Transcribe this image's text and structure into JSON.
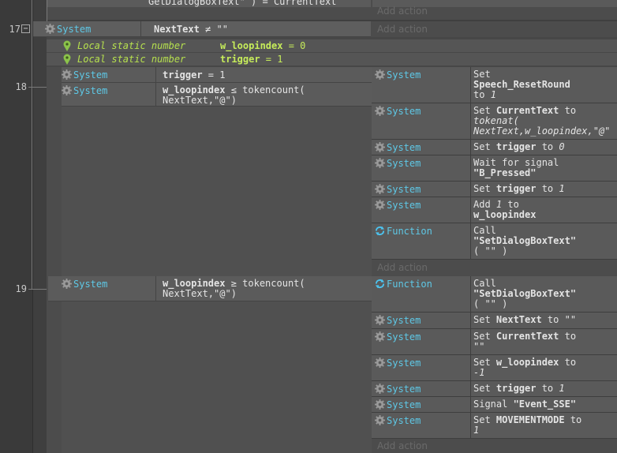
{
  "lines": [
    "17",
    "18",
    "19"
  ],
  "fold_sign": "−",
  "top": {
    "cond_text": "GetDialogBoxText\" ) = CurrentText",
    "add_action": "Add action"
  },
  "e17": {
    "obj": "System",
    "cond_var": "NextText",
    "cond_rest": " ≠ \"\"",
    "add_action": "Add action",
    "locals": [
      {
        "label": "Local static number",
        "name": "w_loopindex",
        "value": " = 0"
      },
      {
        "label": "Local static number",
        "name": "trigger",
        "value": " = 1"
      }
    ]
  },
  "e18": {
    "c1": {
      "obj": "System",
      "var": "trigger",
      "rest": " = 1"
    },
    "c2": {
      "obj": "System",
      "var": "w_loopindex",
      "rest": " ≤ tokencount(",
      "line2": "NextText,\"@\")"
    },
    "a1": {
      "obj": "System",
      "l1": "Set",
      "l2": "Speech_ResetRound",
      "l3a": "to ",
      "l3b": "1"
    },
    "a2": {
      "obj": "System",
      "l1a": "Set ",
      "l1b": "CurrentText",
      "l1c": " to",
      "l2": "tokenat(",
      "l3": "NextText,w_loopindex,\"@\""
    },
    "a3": {
      "obj": "System",
      "p1": "Set ",
      "p2": "trigger",
      "p3": " to ",
      "p4": "0"
    },
    "a4": {
      "obj": "System",
      "l1": "Wait for signal",
      "l2": "\"B_Pressed\""
    },
    "a5": {
      "obj": "System",
      "p1": "Set ",
      "p2": "trigger",
      "p3": " to ",
      "p4": "1"
    },
    "a6": {
      "obj": "System",
      "l1a": "Add ",
      "l1b": "1",
      "l1c": " to",
      "l2": "w_loopindex"
    },
    "a7": {
      "obj": "Function",
      "l1": "Call",
      "l2": "\"SetDialogBoxText\"",
      "l3": "( \"\" )"
    },
    "add_action": "Add action"
  },
  "e19": {
    "c1": {
      "obj": "System",
      "var": "w_loopindex",
      "rest": " ≥ tokencount(",
      "line2": "NextText,\"@\")"
    },
    "a1": {
      "obj": "Function",
      "l1": "Call",
      "l2": "\"SetDialogBoxText\"",
      "l3": "( \"\" )"
    },
    "a2": {
      "obj": "System",
      "p1": "Set ",
      "p2": "NextText",
      "p3": " to ",
      "p4": "\"\""
    },
    "a3": {
      "obj": "System",
      "l1a": "Set ",
      "l1b": "CurrentText",
      "l1c": " to",
      "l2": "\"\""
    },
    "a4": {
      "obj": "System",
      "l1a": "Set ",
      "l1b": "w_loopindex",
      "l1c": " to",
      "l2": "-1"
    },
    "a5": {
      "obj": "System",
      "p1": "Set ",
      "p2": "trigger",
      "p3": " to ",
      "p4": "1"
    },
    "a6": {
      "obj": "System",
      "p1": "Signal ",
      "p2": "\"Event_SSE\""
    },
    "a7": {
      "obj": "System",
      "l1a": "Set ",
      "l1b": "MOVEMENTMODE",
      "l1c": " to",
      "l2": "1"
    },
    "add_action": "Add action"
  },
  "colors": {
    "object": "#5ec8e6",
    "local_var": "#b6e04e",
    "add_action": "#6a6a6a"
  },
  "icons": {
    "system": "gear-icon",
    "function": "function-loop-icon",
    "local_var": "pin-icon",
    "fold": "collapse-icon"
  }
}
